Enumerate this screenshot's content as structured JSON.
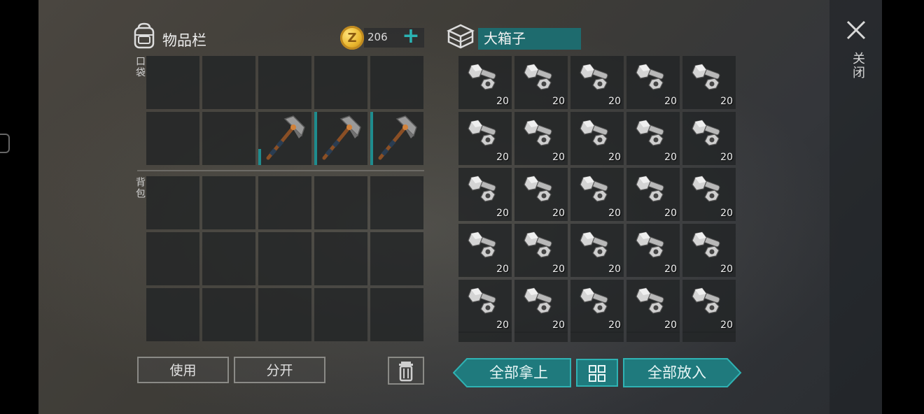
{
  "inventory": {
    "title": "物品栏",
    "coins": "206",
    "pocket_label": "口袋",
    "backpack_label": "背包",
    "pocket_slots": [
      {
        "item": "",
        "qty": ""
      },
      {
        "item": "",
        "qty": ""
      },
      {
        "item": "",
        "qty": ""
      },
      {
        "item": "",
        "qty": ""
      },
      {
        "item": "",
        "qty": ""
      },
      {
        "item": "",
        "qty": ""
      },
      {
        "item": "",
        "qty": ""
      },
      {
        "item": "pickaxe",
        "qty": "",
        "durability": 0.3
      },
      {
        "item": "pickaxe",
        "qty": "",
        "durability": 1.0
      },
      {
        "item": "pickaxe",
        "qty": "",
        "durability": 1.0
      }
    ],
    "backpack_slots": 15
  },
  "chest": {
    "name": "大箱子",
    "items": [
      {
        "item": "bolts-and-nuts",
        "qty": "20"
      },
      {
        "item": "bolts-and-nuts",
        "qty": "20"
      },
      {
        "item": "bolts-and-nuts",
        "qty": "20"
      },
      {
        "item": "bolts-and-nuts",
        "qty": "20"
      },
      {
        "item": "bolts-and-nuts",
        "qty": "20"
      },
      {
        "item": "bolts-and-nuts",
        "qty": "20"
      },
      {
        "item": "bolts-and-nuts",
        "qty": "20"
      },
      {
        "item": "bolts-and-nuts",
        "qty": "20"
      },
      {
        "item": "bolts-and-nuts",
        "qty": "20"
      },
      {
        "item": "bolts-and-nuts",
        "qty": "20"
      },
      {
        "item": "bolts-and-nuts",
        "qty": "20"
      },
      {
        "item": "bolts-and-nuts",
        "qty": "20"
      },
      {
        "item": "bolts-and-nuts",
        "qty": "20"
      },
      {
        "item": "bolts-and-nuts",
        "qty": "20"
      },
      {
        "item": "bolts-and-nuts",
        "qty": "20"
      },
      {
        "item": "bolts-and-nuts",
        "qty": "20"
      },
      {
        "item": "bolts-and-nuts",
        "qty": "20"
      },
      {
        "item": "bolts-and-nuts",
        "qty": "20"
      },
      {
        "item": "bolts-and-nuts",
        "qty": "20"
      },
      {
        "item": "bolts-and-nuts",
        "qty": "20"
      },
      {
        "item": "bolts-and-nuts",
        "qty": "20"
      },
      {
        "item": "bolts-and-nuts",
        "qty": "20"
      },
      {
        "item": "bolts-and-nuts",
        "qty": "20"
      },
      {
        "item": "bolts-and-nuts",
        "qty": "20"
      },
      {
        "item": "bolts-and-nuts",
        "qty": "20"
      }
    ]
  },
  "buttons": {
    "use": "使用",
    "split": "分开",
    "take_all": "全部拿上",
    "put_all": "全部放入",
    "close": "关闭"
  },
  "icons": {
    "backpack": "backpack-icon",
    "coin": "coin-icon",
    "coin_glyph": "Z",
    "plus": "plus-icon",
    "plus_glyph": "+",
    "chest": "chest-icon",
    "trash": "trash-icon",
    "sort": "sort-grid-icon",
    "close": "close-icon"
  },
  "colors": {
    "accent_teal": "#1f7a7d",
    "accent_teal_border": "#2fb2b3",
    "coin_gold": "#e8b52c"
  }
}
